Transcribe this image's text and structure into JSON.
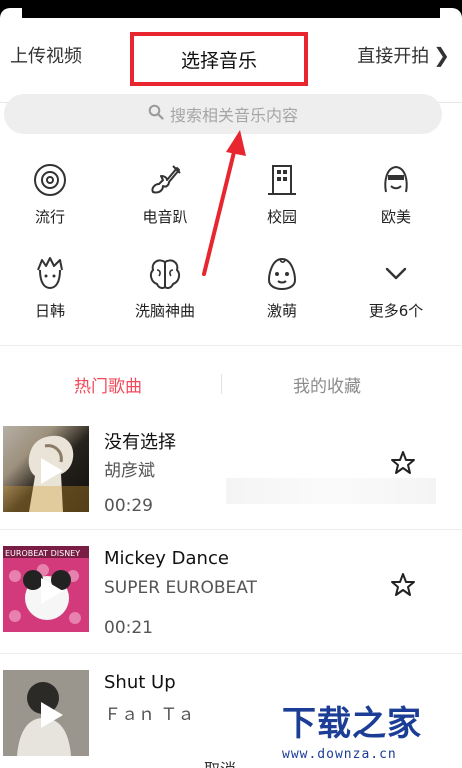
{
  "header": {
    "left_tab": "上传视频",
    "center_title": "选择音乐",
    "right_tab": "直接开拍"
  },
  "search": {
    "placeholder": "搜索相关音乐内容"
  },
  "categories": [
    {
      "label": "流行",
      "icon": "vinyl-disc-icon"
    },
    {
      "label": "电音趴",
      "icon": "electric-guitar-icon"
    },
    {
      "label": "校园",
      "icon": "school-building-icon"
    },
    {
      "label": "欧美",
      "icon": "western-face-icon"
    },
    {
      "label": "日韩",
      "icon": "spiky-hair-face-icon"
    },
    {
      "label": "洗脑神曲",
      "icon": "brain-icon"
    },
    {
      "label": "激萌",
      "icon": "cute-egg-face-icon"
    },
    {
      "label": "更多6个",
      "icon": "chevron-down-icon"
    }
  ],
  "tabs": {
    "hot": "热门歌曲",
    "favorites": "我的收藏"
  },
  "songs": [
    {
      "title": "没有选择",
      "artist": "胡彦斌",
      "duration": "00:29"
    },
    {
      "title": "Mickey Dance",
      "artist": "SUPER EUROBEAT",
      "duration": "00:21",
      "cover_text": "EUROBEAT DISNEY"
    },
    {
      "title": "Shut Up",
      "artist": "Ｆａｎ Ｔａ",
      "duration": ""
    }
  ],
  "footer": {
    "cancel": "取消"
  },
  "watermark": {
    "brand": "下载之家",
    "url": "www.downza.cn"
  },
  "colors": {
    "accent_red": "#f14a5a",
    "highlight_box": "#e8262f",
    "watermark_blue": "#1b3d96"
  }
}
